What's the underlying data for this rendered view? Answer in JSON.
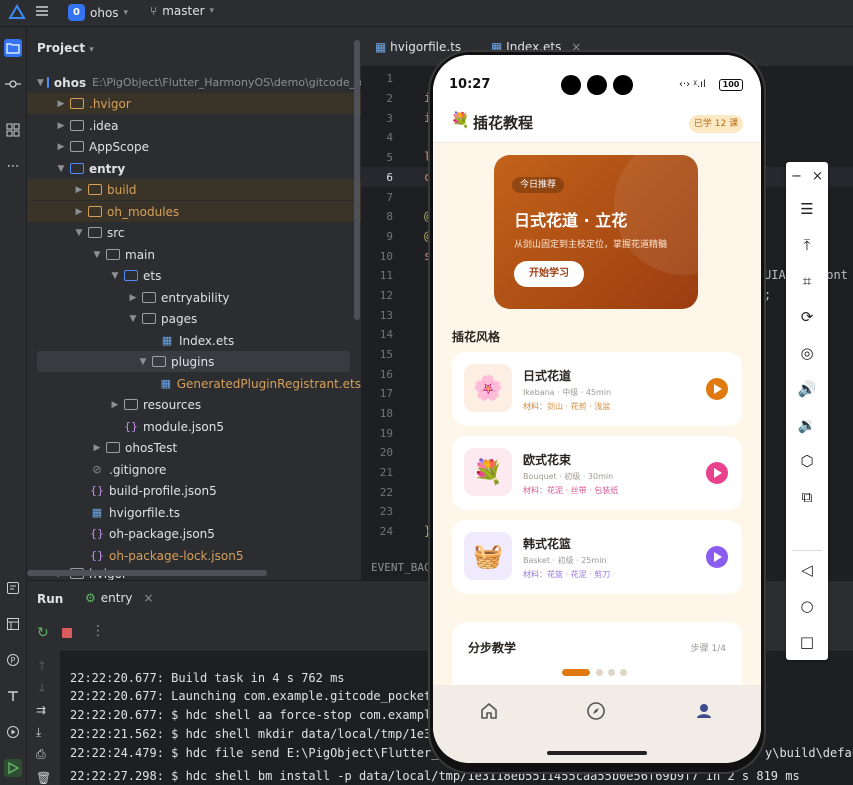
{
  "topbar": {
    "project_badge": "0",
    "project_name": "ohos",
    "branch": "master"
  },
  "project_panel": {
    "title": "Project",
    "rows": [
      {
        "label": "ohos",
        "extra": "E:\\PigObject\\Flutter_HarmonyOS\\demo\\gitcode_p"
      },
      {
        "label": ".hvigor"
      },
      {
        "label": ".idea"
      },
      {
        "label": "AppScope"
      },
      {
        "label": "entry"
      },
      {
        "label": "build"
      },
      {
        "label": "oh_modules"
      },
      {
        "label": "src"
      },
      {
        "label": "main"
      },
      {
        "label": "ets"
      },
      {
        "label": "entryability"
      },
      {
        "label": "pages"
      },
      {
        "label": "Index.ets"
      },
      {
        "label": "plugins"
      },
      {
        "label": "GeneratedPluginRegistrant.ets"
      },
      {
        "label": "resources"
      },
      {
        "label": "module.json5"
      },
      {
        "label": "ohosTest"
      },
      {
        "label": ".gitignore"
      },
      {
        "label": "build-profile.json5"
      },
      {
        "label": "hvigorfile.ts"
      },
      {
        "label": "oh-package.json5"
      },
      {
        "label": "oh-package-lock.json5"
      },
      {
        "label": "hvigor"
      }
    ]
  },
  "editor": {
    "tabs": [
      "hvigorfile.ts",
      "Index.ets"
    ],
    "line_numbers": [
      "1",
      "2",
      "3",
      "4",
      "5",
      "6",
      "7",
      "8",
      "9",
      "10",
      "11",
      "12",
      "13",
      "14",
      "15",
      "16",
      "17",
      "18",
      "19",
      "20",
      "21",
      "22",
      "23",
      "24"
    ],
    "code_fragments": {
      "l2": "i",
      "l3": "i",
      "l5": "l",
      "l6": "c",
      "l8": "@",
      "l9": "@",
      "l10": "s",
      "l11": "UIAb",
      "l11b": "Cont",
      "l12": ";",
      "l24": "}"
    },
    "status_text": "EVENT_BAC"
  },
  "run_panel": {
    "tab_run": "Run",
    "tab_entry": "entry",
    "logs": [
      "22:22:20.677: Build task in 4 s 762 ms",
      "22:22:20.677: Launching com.example.gitcode_pocket",
      "22:22:20.677: $ hdc shell aa force-stop com.exampl",
      "22:22:21.562: $ hdc shell mkdir data/local/tmp/1e3",
      "22:22:24.479: $ hdc file send E:\\PigObject\\Flutter_",
      "22:22:27.298: $ hdc shell bm install -p data/local/tmp/1e3118eb5511455caa55b0e56f69b9f7 in 2 s 819 ms"
    ],
    "log_right_fragment": "y\\build\\defaul"
  },
  "phone": {
    "time": "10:27",
    "battery": "100",
    "app_title": "插花教程",
    "learned_badge": "已学 12 课",
    "banner": {
      "tag": "今日推荐",
      "title": "日式花道 · 立花",
      "subtitle": "从剑山固定到主枝定位，掌握花道精髓",
      "button": "开始学习"
    },
    "section_title": "插花风格",
    "cards": [
      {
        "title": "日式花道",
        "meta": "Ikebana · 中级 · 45min",
        "materials": "材料：剑山 · 花剪 · 浅盆",
        "accent": "#e07a10",
        "thumb_bg": "#fdeee4"
      },
      {
        "title": "欧式花束",
        "meta": "Bouquet · 初级 · 30min",
        "materials": "材料：花泥 · 丝带 · 包装纸",
        "accent": "#e8418d",
        "thumb_bg": "#fdeaf1"
      },
      {
        "title": "韩式花篮",
        "meta": "Basket · 初级 · 25min",
        "materials": "材料：花篮 · 花泥 · 剪刀",
        "accent": "#8a5cf0",
        "thumb_bg": "#efeafc"
      }
    ],
    "steps": {
      "title": "分步教学",
      "progress": "步骤 1/4"
    }
  },
  "colors": {
    "accent_blue": "#3574f0",
    "banner_orange": "#c2621a",
    "tabbar_active": "#3d4a8c"
  }
}
